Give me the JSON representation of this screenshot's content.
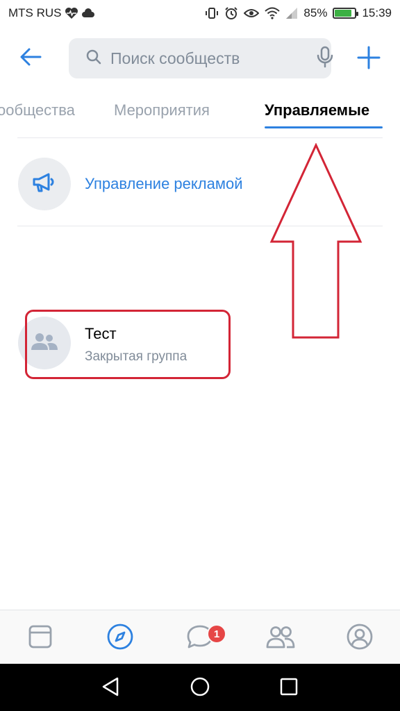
{
  "status_bar": {
    "carrier": "MTS RUS",
    "battery_percent": "85%",
    "battery_level": 0.85,
    "time": "15:39",
    "icons": [
      "heart-pulse-icon",
      "cloud-icon",
      "vibrate-icon",
      "alarm-icon",
      "eye-icon",
      "wifi-icon",
      "signal-icon",
      "battery-icon"
    ]
  },
  "header": {
    "back_icon": "arrow-left-icon",
    "search_placeholder": "Поиск сообществ",
    "search_icon": "search-icon",
    "mic_icon": "mic-icon",
    "add_icon": "plus-icon"
  },
  "tabs": [
    {
      "label": "ообщества",
      "active": false
    },
    {
      "label": "Мероприятия",
      "active": false
    },
    {
      "label": "Управляемые",
      "active": true
    }
  ],
  "ad_management": {
    "label": "Управление рекламой",
    "icon": "megaphone-icon"
  },
  "communities": [
    {
      "name": "Тест",
      "type": "Закрытая группа",
      "icon": "users-icon"
    }
  ],
  "bottom_nav": {
    "items": [
      "newsfeed-icon",
      "explore-icon",
      "messages-icon",
      "friends-icon",
      "profile-icon"
    ],
    "active_index": 1,
    "messages_badge": "1"
  },
  "colors": {
    "accent": "#2d81e0",
    "annotation": "#d32536",
    "badge": "#e64646",
    "secondary_text": "#818c99"
  }
}
